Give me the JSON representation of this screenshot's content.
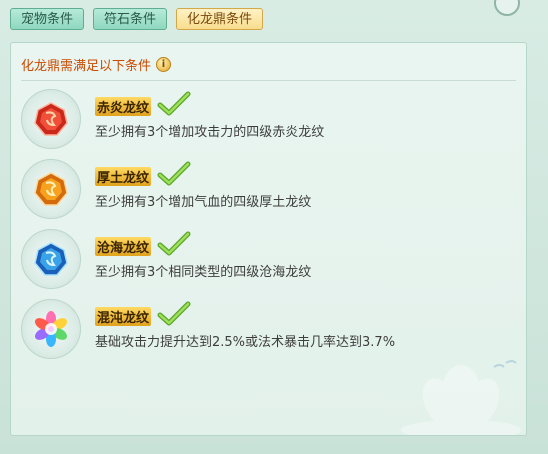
{
  "tabs": [
    {
      "label": "宠物条件",
      "active": false
    },
    {
      "label": "符石条件",
      "active": false
    },
    {
      "label": "化龙鼎条件",
      "active": true
    }
  ],
  "panel": {
    "title": "化龙鼎需满足以下条件"
  },
  "conditions": [
    {
      "name": "赤炎龙纹",
      "desc": "至少拥有3个增加攻击力的四级赤炎龙纹",
      "icon": "red-gem-icon",
      "met": true
    },
    {
      "name": "厚土龙纹",
      "desc": "至少拥有3个增加气血的四级厚土龙纹",
      "icon": "orange-gem-icon",
      "met": true
    },
    {
      "name": "沧海龙纹",
      "desc": "至少拥有3个相同类型的四级沧海龙纹",
      "icon": "blue-gem-icon",
      "met": true
    },
    {
      "name": "混沌龙纹",
      "desc": "基础攻击力提升达到2.5%或法术暴击几率达到3.7%",
      "icon": "rainbow-flower-gem-icon",
      "met": true
    }
  ],
  "colors": {
    "title": "#cc4a00",
    "check": "#7cc63a",
    "active_tab": "#f8dd8e",
    "inactive_tab": "#8fd8bf"
  }
}
